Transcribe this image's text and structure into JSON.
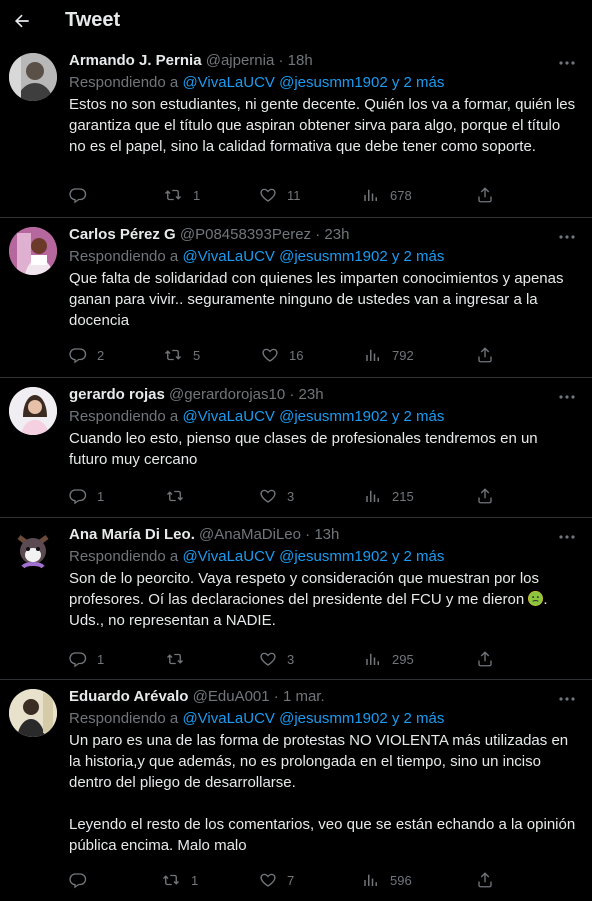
{
  "header": {
    "title": "Tweet"
  },
  "labels": {
    "replying_prefix": "Respondiendo a"
  },
  "tweets": [
    {
      "name": "Armando J. Pernia",
      "handle": "@ajpernia",
      "time": "18h",
      "replying_to": "@VivaLaUCV @jesusmm1902 y 2 más",
      "text": "Estos no son estudiantes, ni gente decente. Quién los va a formar, quién les garantiza que el título que aspiran obtener sirva para algo, porque el título no es el papel, sino la calidad formativa que debe tener como soporte.",
      "replies": "",
      "retweets": "1",
      "likes": "11",
      "views": "678"
    },
    {
      "name": "Carlos Pérez G",
      "handle": "@P08458393Perez",
      "time": "23h",
      "replying_to": "@VivaLaUCV @jesusmm1902 y 2 más",
      "text": "Que falta de solidaridad con quienes les imparten conocimientos y apenas ganan para vivir.. seguramente ninguno de ustedes van a ingresar a la docencia",
      "replies": "2",
      "retweets": "5",
      "likes": "16",
      "views": "792"
    },
    {
      "name": "gerardo rojas",
      "handle": "@gerardorojas10",
      "time": "23h",
      "replying_to": "@VivaLaUCV @jesusmm1902 y 2 más",
      "text": "Cuando leo esto, pienso que clases de profesionales tendremos en un futuro muy cercano",
      "replies": "1",
      "retweets": "",
      "likes": "3",
      "views": "215"
    },
    {
      "name": "Ana María Di Leo.",
      "handle": "@AnaMaDiLeo",
      "time": "13h",
      "replying_to": "@VivaLaUCV @jesusmm1902 y 2 más",
      "text": "Son de lo peorcito. Vaya respeto y consideración que muestran por los profesores. Oí las declaraciones del presidente del FCU y me dieron",
      "text_tail": ". Uds., no representan a NADIE.",
      "emoji": "nauseated-face-emoji",
      "replies": "1",
      "retweets": "",
      "likes": "3",
      "views": "295"
    },
    {
      "name": "Eduardo Arévalo",
      "handle": "@EduA001",
      "time": "1 mar.",
      "replying_to": "@VivaLaUCV @jesusmm1902 y 2 más",
      "text": "Un paro es una de las forma de protestas NO VIOLENTA más utilizadas en la historia,y que además, no es prolongada en el tiempo, sino un inciso dentro del pliego de desarrollarse.\n\nLeyendo el resto de los comentarios, veo que se están echando a la opinión pública encima. Malo malo",
      "replies": "",
      "retweets": "1",
      "likes": "7",
      "views": "596"
    }
  ]
}
